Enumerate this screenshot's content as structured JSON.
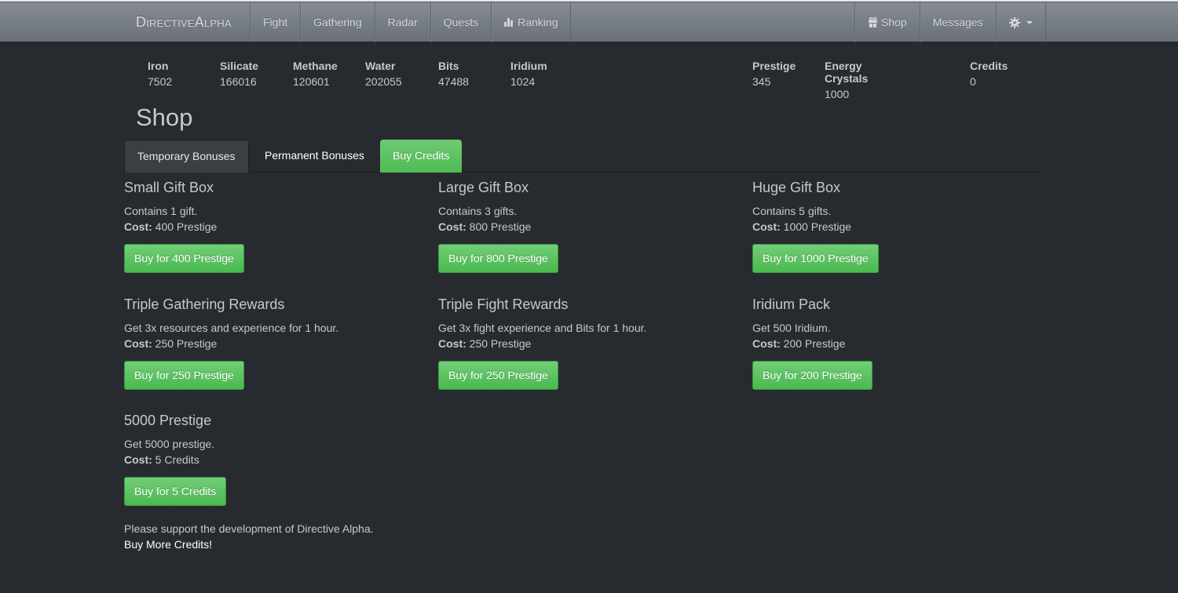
{
  "navbar": {
    "brand": "DirectiveAlpha",
    "left_items": [
      {
        "label": "Fight"
      },
      {
        "label": "Gathering"
      },
      {
        "label": "Radar"
      },
      {
        "label": "Quests"
      },
      {
        "label": "Ranking",
        "icon": "bar-chart-icon"
      }
    ],
    "right_items": [
      {
        "label": "Shop",
        "icon": "gift-icon"
      },
      {
        "label": "Messages"
      },
      {
        "label": "",
        "icon": "gear-icon"
      }
    ]
  },
  "resources": [
    {
      "label": "Iron",
      "value": "7502"
    },
    {
      "label": "Silicate",
      "value": "166016"
    },
    {
      "label": "Methane",
      "value": "120601"
    },
    {
      "label": "Water",
      "value": "202055"
    },
    {
      "label": "Bits",
      "value": "47488"
    },
    {
      "label": "Iridium",
      "value": "1024"
    },
    {
      "label": "Prestige",
      "value": "345"
    },
    {
      "label": "Energy Crystals",
      "value": "1000"
    },
    {
      "label": "Credits",
      "value": "0"
    }
  ],
  "page_title": "Shop",
  "tabs": [
    {
      "label": "Temporary Bonuses",
      "active": true
    },
    {
      "label": "Permanent Bonuses"
    },
    {
      "label": "Buy Credits"
    }
  ],
  "cost_label": "Cost:",
  "items": [
    {
      "title": "Small Gift Box",
      "desc": "Contains 1 gift.",
      "cost": "400 Prestige",
      "button": "Buy for 400 Prestige"
    },
    {
      "title": "Large Gift Box",
      "desc": "Contains 3 gifts.",
      "cost": "800 Prestige",
      "button": "Buy for 800 Prestige"
    },
    {
      "title": "Huge Gift Box",
      "desc": "Contains 5 gifts.",
      "cost": "1000 Prestige",
      "button": "Buy for 1000 Prestige"
    },
    {
      "title": "Triple Gathering Rewards",
      "desc": "Get 3x resources and experience for 1 hour.",
      "cost": "250 Prestige",
      "button": "Buy for 250 Prestige"
    },
    {
      "title": "Triple Fight Rewards",
      "desc": "Get 3x fight experience and Bits for 1 hour.",
      "cost": "250 Prestige",
      "button": "Buy for 250 Prestige"
    },
    {
      "title": "Iridium Pack",
      "desc": "Get 500 Iridium.",
      "cost": "200 Prestige",
      "button": "Buy for 200 Prestige"
    },
    {
      "title": "5000 Prestige",
      "desc": "Get 5000 prestige.",
      "cost": "5 Credits",
      "button": "Buy for 5 Credits"
    }
  ],
  "footer": {
    "note": "Please support the development of Directive Alpha.",
    "link": "Buy More Credits!"
  },
  "colors": {
    "background": "#272b30",
    "accent_green": "#5cb85c",
    "navbar": "#7a8088"
  }
}
